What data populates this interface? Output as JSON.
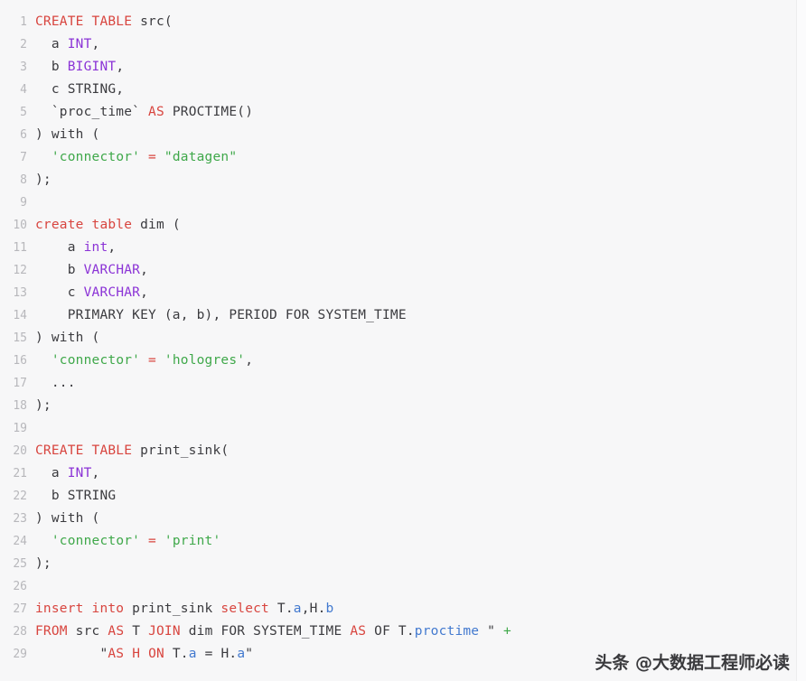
{
  "editor": {
    "language": "SQL",
    "first_line_number": 1,
    "last_line_number": 29,
    "colors": {
      "background": "#f7f7f8",
      "line_number": "#b7b7bb",
      "keyword": "#d8453f",
      "type": "#8b33d6",
      "string": "#3fa84a",
      "identifier": "#4279cf",
      "plain_text": "#3b3b3f"
    },
    "lines": [
      {
        "n": "1",
        "tokens": [
          {
            "t": "CREATE TABLE ",
            "c": "kw"
          },
          {
            "t": "src(",
            "c": "plain"
          }
        ]
      },
      {
        "n": "2",
        "tokens": [
          {
            "t": "  a ",
            "c": "plain"
          },
          {
            "t": "INT",
            "c": "type"
          },
          {
            "t": ",",
            "c": "plain"
          }
        ]
      },
      {
        "n": "3",
        "tokens": [
          {
            "t": "  b ",
            "c": "plain"
          },
          {
            "t": "BIGINT",
            "c": "type"
          },
          {
            "t": ",",
            "c": "plain"
          }
        ]
      },
      {
        "n": "4",
        "tokens": [
          {
            "t": "  c STRING,",
            "c": "plain"
          }
        ]
      },
      {
        "n": "5",
        "tokens": [
          {
            "t": "  `proc_time` ",
            "c": "plain"
          },
          {
            "t": "AS",
            "c": "kw"
          },
          {
            "t": " PROCTIME()",
            "c": "plain"
          }
        ]
      },
      {
        "n": "6",
        "tokens": [
          {
            "t": ") with (",
            "c": "plain"
          }
        ]
      },
      {
        "n": "7",
        "tokens": [
          {
            "t": "  ",
            "c": "plain"
          },
          {
            "t": "'connector'",
            "c": "str"
          },
          {
            "t": " = ",
            "c": "op"
          },
          {
            "t": "\"datagen\"",
            "c": "str"
          }
        ]
      },
      {
        "n": "8",
        "tokens": [
          {
            "t": ");",
            "c": "plain"
          }
        ]
      },
      {
        "n": "9",
        "tokens": [
          {
            "t": "",
            "c": "plain"
          }
        ]
      },
      {
        "n": "10",
        "tokens": [
          {
            "t": "create table ",
            "c": "kw"
          },
          {
            "t": "dim (",
            "c": "plain"
          }
        ]
      },
      {
        "n": "11",
        "tokens": [
          {
            "t": "    a ",
            "c": "plain"
          },
          {
            "t": "int",
            "c": "type"
          },
          {
            "t": ",",
            "c": "plain"
          }
        ]
      },
      {
        "n": "12",
        "tokens": [
          {
            "t": "    b ",
            "c": "plain"
          },
          {
            "t": "VARCHAR",
            "c": "type"
          },
          {
            "t": ",",
            "c": "plain"
          }
        ]
      },
      {
        "n": "13",
        "tokens": [
          {
            "t": "    c ",
            "c": "plain"
          },
          {
            "t": "VARCHAR",
            "c": "type"
          },
          {
            "t": ",",
            "c": "plain"
          }
        ]
      },
      {
        "n": "14",
        "tokens": [
          {
            "t": "    PRIMARY KEY (a, b), PERIOD FOR SYSTEM_TIME",
            "c": "plain"
          }
        ]
      },
      {
        "n": "15",
        "tokens": [
          {
            "t": ") with (",
            "c": "plain"
          }
        ]
      },
      {
        "n": "16",
        "tokens": [
          {
            "t": "  ",
            "c": "plain"
          },
          {
            "t": "'connector'",
            "c": "str"
          },
          {
            "t": " = ",
            "c": "op"
          },
          {
            "t": "'hologres'",
            "c": "str"
          },
          {
            "t": ",",
            "c": "plain"
          }
        ]
      },
      {
        "n": "17",
        "tokens": [
          {
            "t": "  ...",
            "c": "plain"
          }
        ]
      },
      {
        "n": "18",
        "tokens": [
          {
            "t": ");",
            "c": "plain"
          }
        ]
      },
      {
        "n": "19",
        "tokens": [
          {
            "t": "",
            "c": "plain"
          }
        ]
      },
      {
        "n": "20",
        "tokens": [
          {
            "t": "CREATE TABLE ",
            "c": "kw"
          },
          {
            "t": "print_sink(",
            "c": "plain"
          }
        ]
      },
      {
        "n": "21",
        "tokens": [
          {
            "t": "  a ",
            "c": "plain"
          },
          {
            "t": "INT",
            "c": "type"
          },
          {
            "t": ",",
            "c": "plain"
          }
        ]
      },
      {
        "n": "22",
        "tokens": [
          {
            "t": "  b STRING",
            "c": "plain"
          }
        ]
      },
      {
        "n": "23",
        "tokens": [
          {
            "t": ") with (",
            "c": "plain"
          }
        ]
      },
      {
        "n": "24",
        "tokens": [
          {
            "t": "  ",
            "c": "plain"
          },
          {
            "t": "'connector'",
            "c": "str"
          },
          {
            "t": " = ",
            "c": "op"
          },
          {
            "t": "'print'",
            "c": "str"
          }
        ]
      },
      {
        "n": "25",
        "tokens": [
          {
            "t": ");",
            "c": "plain"
          }
        ]
      },
      {
        "n": "26",
        "tokens": [
          {
            "t": "",
            "c": "plain"
          }
        ]
      },
      {
        "n": "27",
        "tokens": [
          {
            "t": "insert into ",
            "c": "kw"
          },
          {
            "t": "print_sink ",
            "c": "plain"
          },
          {
            "t": "select",
            "c": "kw"
          },
          {
            "t": " T.",
            "c": "plain"
          },
          {
            "t": "a",
            "c": "ident"
          },
          {
            "t": ",H.",
            "c": "plain"
          },
          {
            "t": "b",
            "c": "ident"
          }
        ]
      },
      {
        "n": "28",
        "tokens": [
          {
            "t": "FROM",
            "c": "kw"
          },
          {
            "t": " src ",
            "c": "plain"
          },
          {
            "t": "AS",
            "c": "kw"
          },
          {
            "t": " T ",
            "c": "plain"
          },
          {
            "t": "JOIN",
            "c": "kw"
          },
          {
            "t": " dim FOR SYSTEM_TIME ",
            "c": "plain"
          },
          {
            "t": "AS",
            "c": "kw"
          },
          {
            "t": " OF T.",
            "c": "plain"
          },
          {
            "t": "proctime",
            "c": "ident"
          },
          {
            "t": " \" ",
            "c": "plain"
          },
          {
            "t": "+",
            "c": "str"
          }
        ]
      },
      {
        "n": "29",
        "tokens": [
          {
            "t": "        \"",
            "c": "plain"
          },
          {
            "t": "AS",
            "c": "kw"
          },
          {
            "t": " ",
            "c": "plain"
          },
          {
            "t": "H",
            "c": "kw"
          },
          {
            "t": " ",
            "c": "plain"
          },
          {
            "t": "ON",
            "c": "kw"
          },
          {
            "t": " T.",
            "c": "plain"
          },
          {
            "t": "a",
            "c": "ident"
          },
          {
            "t": " = H.",
            "c": "plain"
          },
          {
            "t": "a",
            "c": "ident"
          },
          {
            "t": "\"",
            "c": "plain"
          }
        ]
      }
    ]
  },
  "watermark": {
    "text": "头条 @大数据工程师必读"
  }
}
